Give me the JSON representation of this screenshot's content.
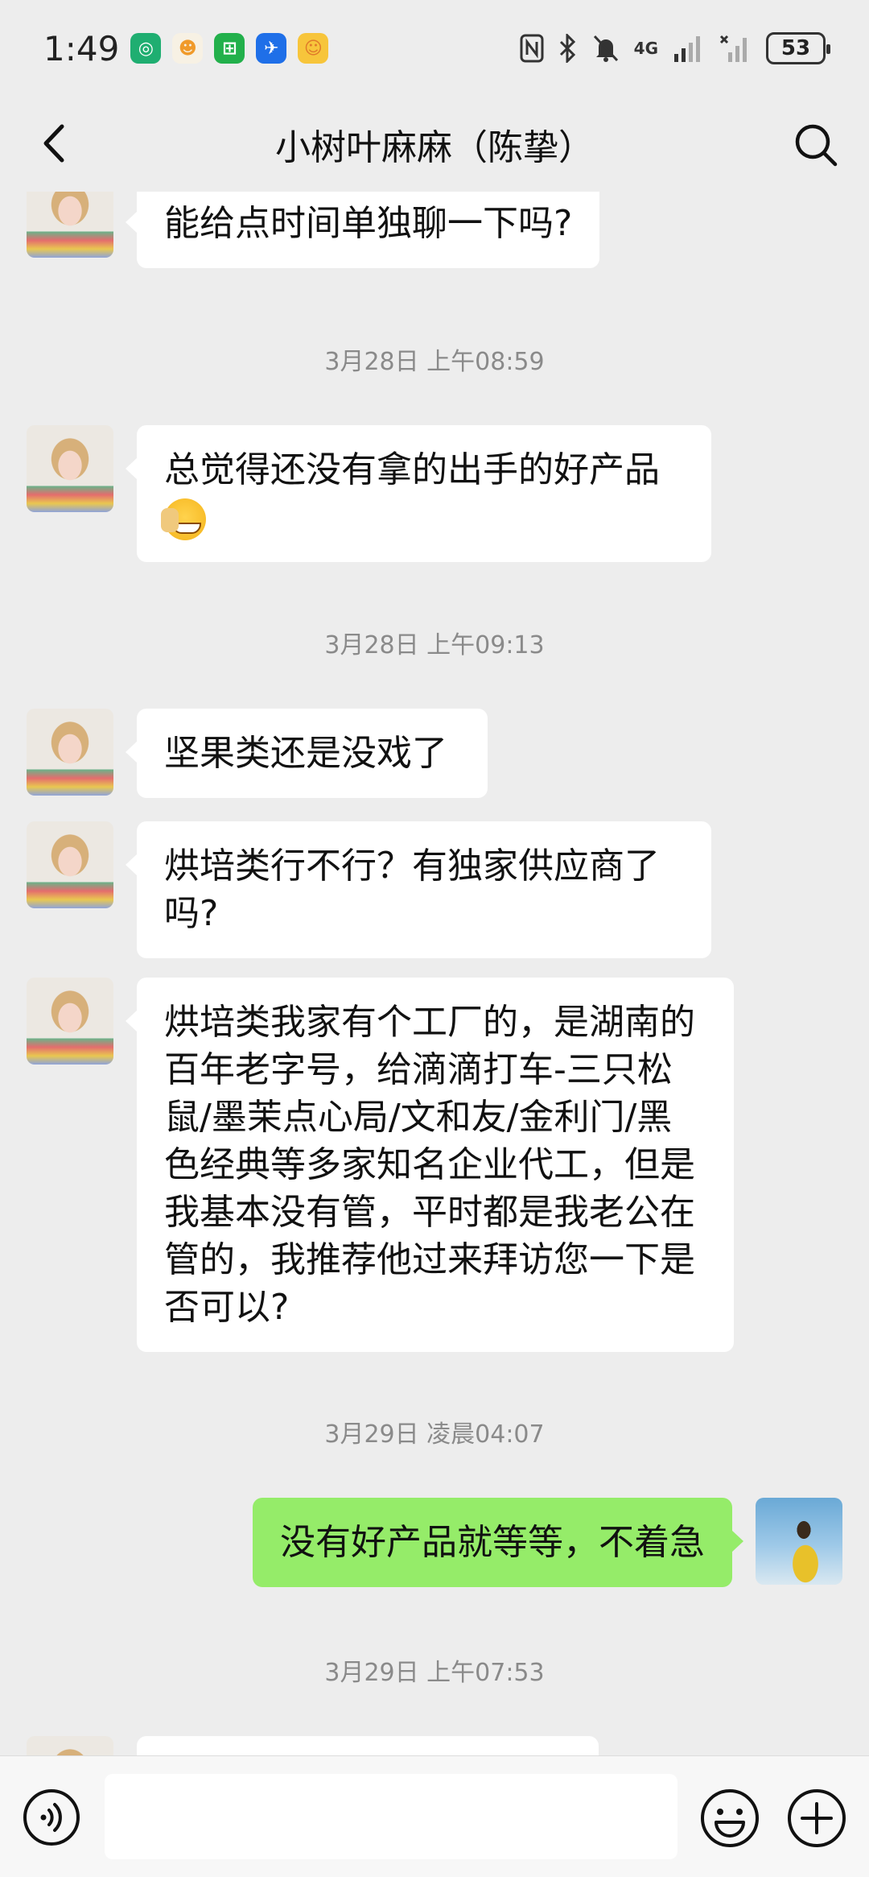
{
  "status_bar": {
    "time": "1:49",
    "network": "4G",
    "battery": "53"
  },
  "header": {
    "title": "小树叶麻麻（陈挚）"
  },
  "messages": [
    {
      "type": "text",
      "from": "other",
      "text": "能给点时间单独聊一下吗?"
    },
    {
      "type": "time",
      "text": "3月28日 上午08:59"
    },
    {
      "type": "text",
      "from": "other",
      "text": "总觉得还没有拿的出手的好产品"
    },
    {
      "type": "time",
      "text": "3月28日 上午09:13"
    },
    {
      "type": "text",
      "from": "other",
      "text": "坚果类还是没戏了"
    },
    {
      "type": "text",
      "from": "other",
      "text_lines": [
        "烘培类行不行？有独家供应商了",
        "吗?"
      ]
    },
    {
      "type": "text",
      "from": "other",
      "text_lines": [
        "烘培类我家有个工厂的，是湖南的",
        "百年老字号，给滴滴打车-三只松",
        "鼠/墨茉点心局/文和友/金利门/黑",
        "色经典等多家知名企业代工，但是",
        "我基本没有管，平时都是我老公在",
        "管的，我推荐他过来拜访您一下是",
        "否可以?"
      ]
    },
    {
      "type": "time",
      "text": "3月29日 凌晨04:07"
    },
    {
      "type": "text",
      "from": "me",
      "text": "没有好产品就等等，不着急"
    },
    {
      "type": "time",
      "text": "3月29日 上午07:53"
    }
  ],
  "input": {
    "placeholder": ""
  },
  "colors": {
    "background": "#ededed",
    "my_bubble": "#95ec69",
    "other_bubble": "#ffffff"
  }
}
